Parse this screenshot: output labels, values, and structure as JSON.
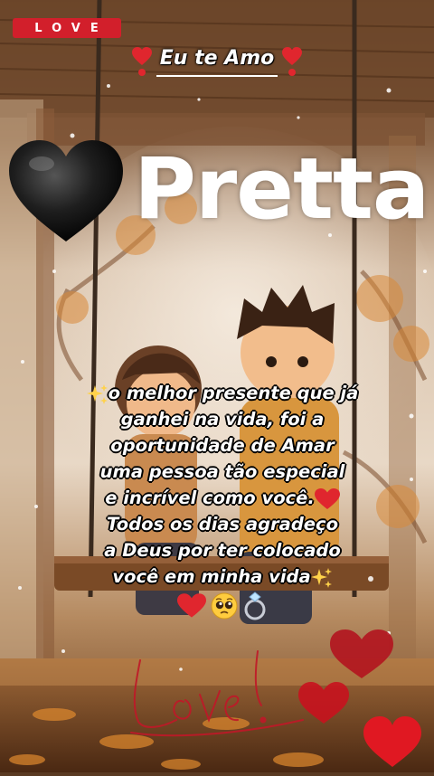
{
  "badge": {
    "label": "LOVE"
  },
  "heading": {
    "text": "Eu te Amo"
  },
  "name": {
    "text": "Pretta"
  },
  "poem": {
    "lines": [
      "o melhor presente que já",
      "ganhei na vida, foi a",
      "oportunidade de Amar",
      "uma pessoa tão especial",
      "e incrível como você.",
      "Todos os dias agradeço",
      "a Deus por ter colocado",
      "você em minha vida"
    ],
    "emojis": [
      "red-heart-icon",
      "pleading-face-icon",
      "ring-icon"
    ]
  },
  "signature": {
    "text": "Love"
  },
  "colors": {
    "badge_red": "#d21f2b",
    "heart_red": "#e0262e",
    "black_heart": "#1a1a1a",
    "text": "#ffffff"
  }
}
